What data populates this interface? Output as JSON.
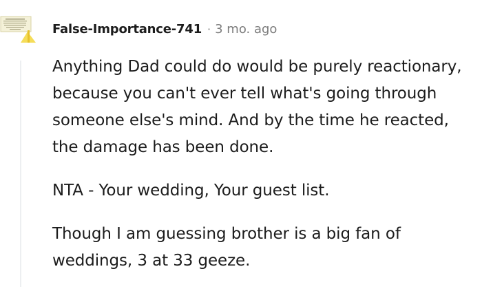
{
  "comment": {
    "username": "False-Importance-741",
    "separator": "·",
    "timestamp": "3 mo. ago",
    "avatar_icon": "newspaper-clipping-avatar-icon",
    "paragraphs": [
      "Anything Dad could do would be purely reactionary, because you can't ever tell what's going through someone else's mind. And by the time he reacted, the damage has been done.",
      "NTA - Your wedding, Your guest list.",
      "Though I am guessing brother is a big fan of weddings, 3 at 33 geeze."
    ]
  },
  "colors": {
    "text": "#1c1c1c",
    "meta": "#7c7c7c",
    "thread_line": "#edeff1",
    "accent": "#f0d03a"
  }
}
